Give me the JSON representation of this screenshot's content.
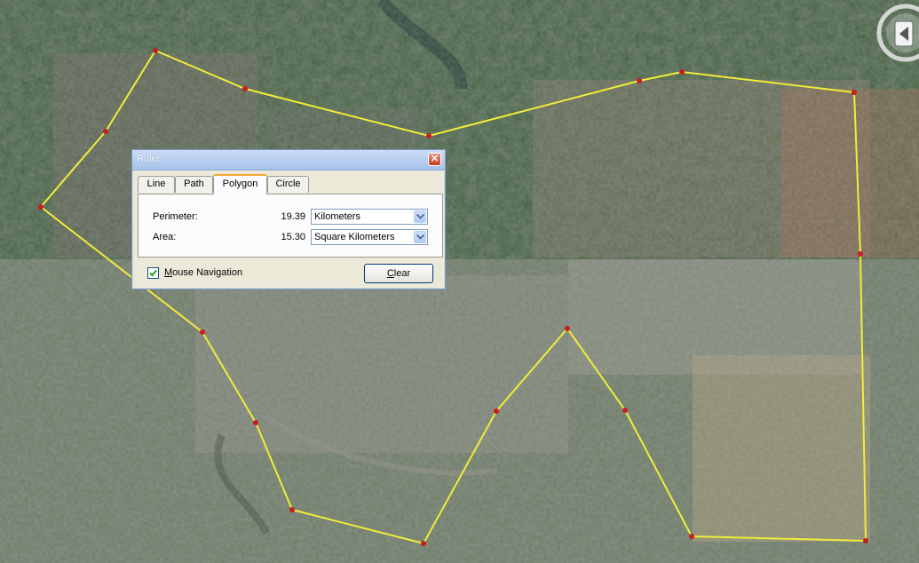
{
  "ruler": {
    "title": "Ruler",
    "close_glyph": "✕",
    "tabs": [
      {
        "label": "Line"
      },
      {
        "label": "Path"
      },
      {
        "label": "Polygon"
      },
      {
        "label": "Circle"
      }
    ],
    "active_tab": "Polygon",
    "perimeter": {
      "label": "Perimeter:",
      "value": "19.39",
      "unit": "Kilometers"
    },
    "area": {
      "label": "Area:",
      "value": "15.30",
      "unit": "Square Kilometers"
    },
    "mouse_navigation": {
      "label": "Mouse Navigation",
      "checked": true
    },
    "clear_label": "Clear"
  },
  "map": {
    "polygon_color": "#f2ec3a",
    "vertex_color": "#c81e1e",
    "icons": [
      "navigation-compass-icon",
      "pan-left-icon"
    ]
  }
}
